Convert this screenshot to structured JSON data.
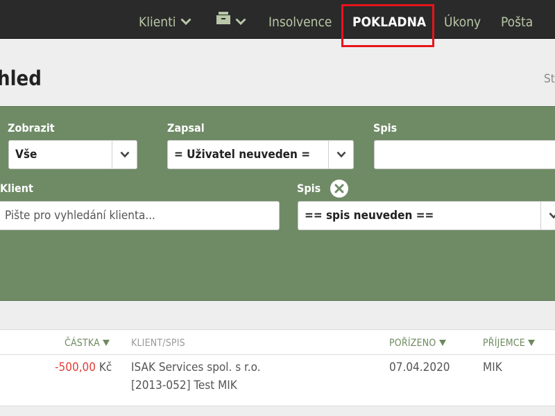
{
  "nav": {
    "clients": "Klienti",
    "archive_icon": "drawer-icon",
    "insolvence": "Insolvence",
    "pokladna": "POKLADNA",
    "ukony": "Úkony",
    "posta": "Pošta"
  },
  "page": {
    "title": "hled",
    "corner": "St"
  },
  "filters": {
    "zobrazit_label": "Zobrazit",
    "zobrazit_value": "Vše",
    "zapsal_label": "Zapsal",
    "zapsal_value": "= Uživatel neuveden =",
    "spis_top_label": "Spis",
    "spis_top_value": "",
    "klient_label": "Klient",
    "klient_placeholder": "Pište pro vyhledání klienta...",
    "spis_label": "Spis",
    "spis_value": "== spis neuveden =="
  },
  "table": {
    "headers": {
      "castka": "ČÁSTKA",
      "klient_spis": "KLIENT/SPIS",
      "porizeno": "POŘÍZENO",
      "prijemce": "PŘÍJEMCE"
    },
    "rows": [
      {
        "amount": "-500,00",
        "currency": "Kč",
        "client": "ISAK Services spol. s r.o.",
        "spis": "[2013-052] Test MIK",
        "date": "07.04.2020",
        "recipient": "MIK"
      }
    ]
  },
  "colors": {
    "nav_bg": "#2a2a2a",
    "panel_bg": "#6f8b66",
    "accent_green": "#6d8a5e",
    "negative": "#e0403a",
    "highlight": "#e8141a"
  }
}
